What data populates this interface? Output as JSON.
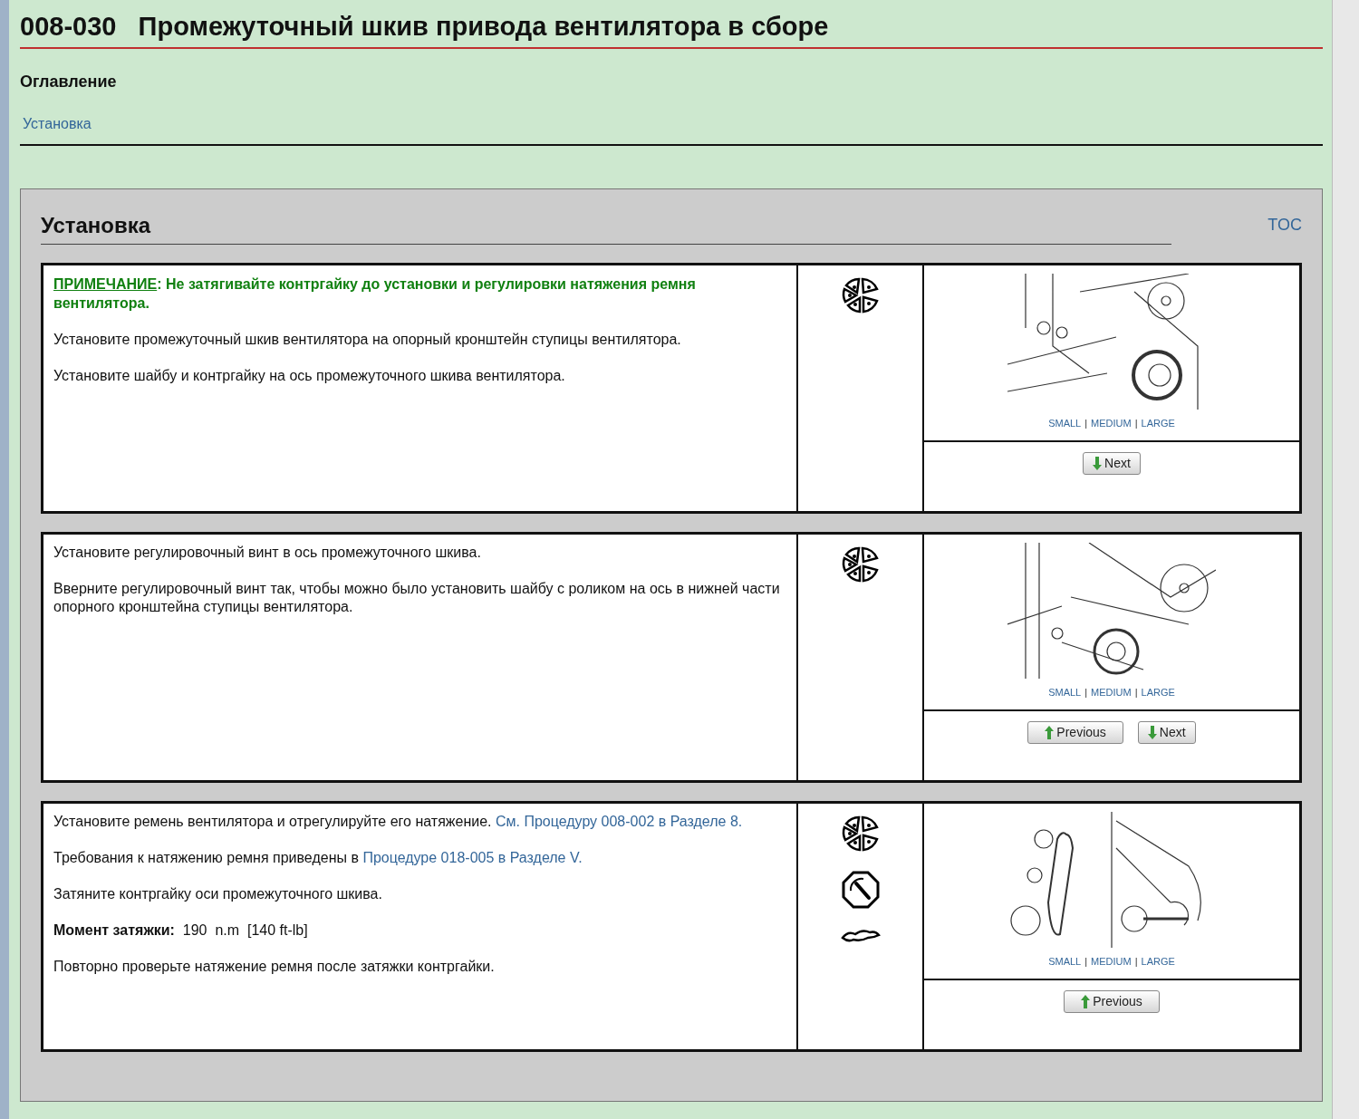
{
  "title": {
    "code": "008-030",
    "text": "Промежуточный шкив привода вентилятора в сборе"
  },
  "contents": {
    "heading": "Оглавление",
    "links": [
      "Установка"
    ]
  },
  "section": {
    "heading": "Установка",
    "toc_link": "TOC",
    "steps": [
      {
        "paragraphs": [
          {
            "kind": "note",
            "label": "ПРИМЕЧАНИЕ",
            "text": ": Не затягивайте контргайку до установки и регулировки натяжения ремня вентилятора."
          },
          {
            "kind": "text",
            "text": "Установите промежуточный шкив вентилятора на опорный кронштейн ступицы вентилятора."
          },
          {
            "kind": "text",
            "text": "Установите шайбу и контргайку на ось промежуточного шкива вентилятора."
          }
        ],
        "icons": [
          {
            "kind": "repair"
          }
        ],
        "image": {
          "kind": "pulley",
          "sizes": [
            "SMALL",
            "MEDIUM",
            "LARGE"
          ],
          "separator": "|"
        },
        "buttons": [
          {
            "kind": "next",
            "label": "Next"
          }
        ]
      },
      {
        "paragraphs": [
          {
            "kind": "text",
            "text": "Установите регулировочный винт в ось промежуточного шкива."
          },
          {
            "kind": "text",
            "text": "Вверните регулировочный винт так, чтобы можно было установить шайбу с роликом на ось в нижней части опорного кронштейна ступицы вентилятора."
          }
        ],
        "icons": [
          {
            "kind": "repair"
          }
        ],
        "image": {
          "kind": "bracket",
          "sizes": [
            "SMALL",
            "MEDIUM",
            "LARGE"
          ],
          "separator": "|"
        },
        "buttons": [
          {
            "kind": "previous",
            "label": "Previous"
          },
          {
            "kind": "next",
            "label": "Next"
          }
        ]
      },
      {
        "paragraphs": [
          {
            "kind": "link",
            "text": "Установите ремень вентилятора и отрегулируйте его натяжение.",
            "link": "См. Процедуру 008-002 в Разделе 8."
          },
          {
            "kind": "link",
            "text": "Требования к натяжению ремня приведены в",
            "link": "Процедуре 018-005 в Разделе V."
          },
          {
            "kind": "text",
            "text": "Затяните контргайку оси промежуточного шкива."
          },
          {
            "kind": "torque",
            "label": "Момент затяжки:",
            "value": "190",
            "unit": "n.m",
            "alt": "[140 ft-lb]"
          },
          {
            "kind": "text",
            "text": "Повторно проверьте натяжение ремня после затяжки контргайки."
          }
        ],
        "icons": [
          {
            "kind": "repair"
          },
          {
            "kind": "torque"
          },
          {
            "kind": "sealant"
          }
        ],
        "image": {
          "kind": "belt",
          "sizes": [
            "SMALL",
            "MEDIUM",
            "LARGE"
          ],
          "separator": "|"
        },
        "buttons": [
          {
            "kind": "previous",
            "label": "Previous"
          }
        ]
      }
    ]
  }
}
